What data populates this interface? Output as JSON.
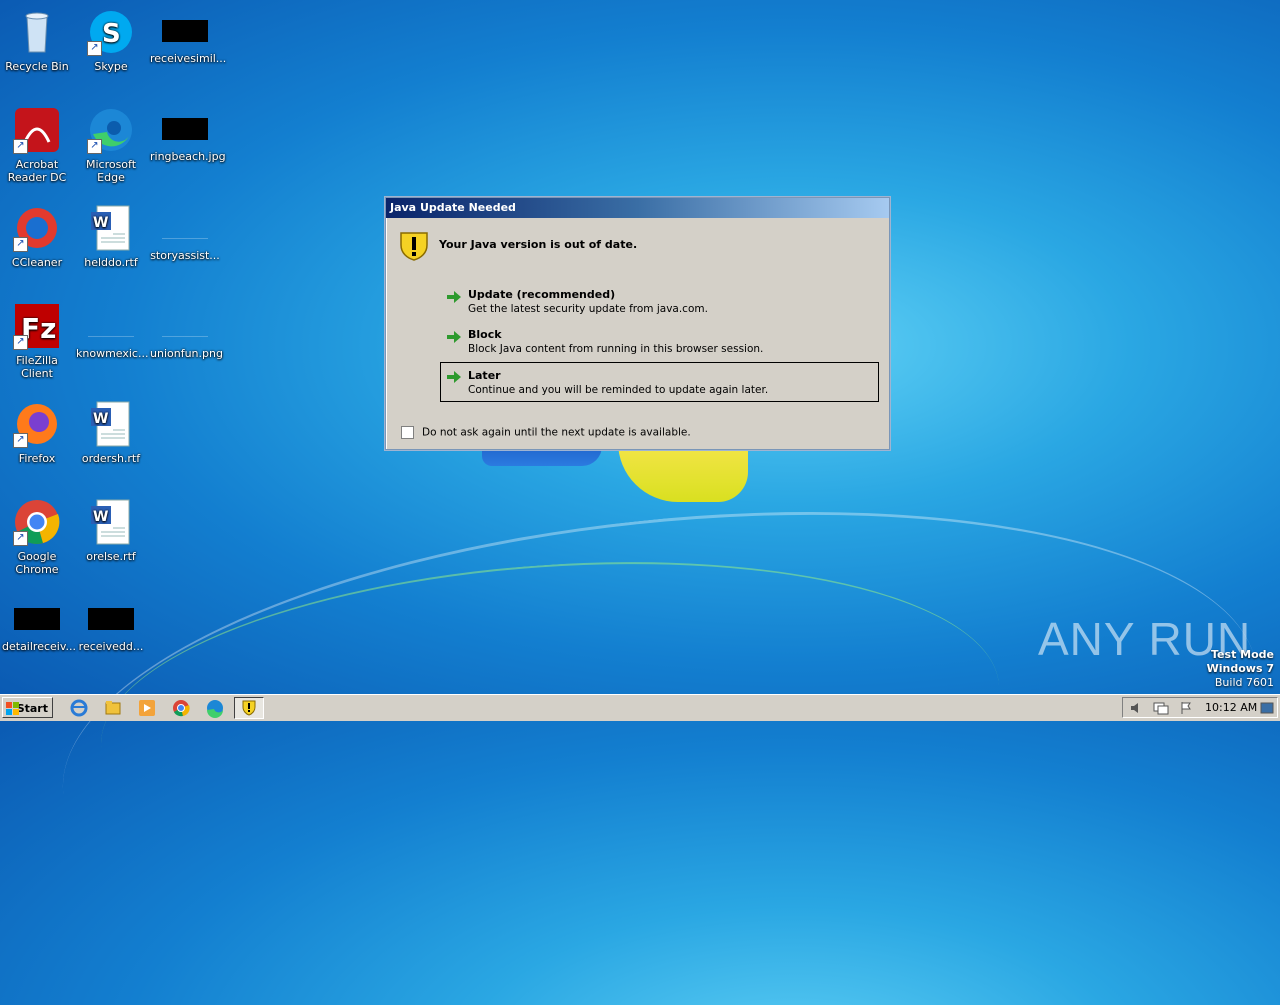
{
  "desktop": {
    "icons": [
      {
        "label": "Recycle Bin",
        "icon": "recycle-bin-icon"
      },
      {
        "label": "Skype",
        "icon": "skype-icon"
      },
      {
        "label": "receivesimil...",
        "icon": "image-thumbnail-icon"
      },
      {
        "label": "Acrobat Reader DC",
        "icon": "acrobat-icon"
      },
      {
        "label": "Microsoft Edge",
        "icon": "edge-icon"
      },
      {
        "label": "ringbeach.jpg",
        "icon": "image-thumbnail-icon"
      },
      {
        "label": "CCleaner",
        "icon": "ccleaner-icon"
      },
      {
        "label": "helddo.rtf",
        "icon": "word-document-icon"
      },
      {
        "label": "storyassist...",
        "icon": "file-icon"
      },
      {
        "label": "FileZilla Client",
        "icon": "filezilla-icon"
      },
      {
        "label": "knowmexic...",
        "icon": "file-icon"
      },
      {
        "label": "unionfun.png",
        "icon": "file-icon"
      },
      {
        "label": "Firefox",
        "icon": "firefox-icon"
      },
      {
        "label": "ordersh.rtf",
        "icon": "word-document-icon"
      },
      {
        "label": "Google Chrome",
        "icon": "chrome-icon"
      },
      {
        "label": "orelse.rtf",
        "icon": "word-document-icon"
      },
      {
        "label": "detailreceiv...",
        "icon": "image-thumbnail-icon"
      },
      {
        "label": "receivedd...",
        "icon": "image-thumbnail-icon"
      }
    ]
  },
  "dialog": {
    "title": "Java Update Needed",
    "heading": "Your Java version is out of date.",
    "options": [
      {
        "title": "Update (recommended)",
        "desc": "Get the latest security update from java.com."
      },
      {
        "title": "Block",
        "desc": "Block Java content from running in this browser session."
      },
      {
        "title": "Later",
        "desc": "Continue and you will be reminded to update again later."
      }
    ],
    "checkbox_label": "Do not ask again until the next update is available.",
    "checkbox_checked": false
  },
  "watermark": {
    "text": "ANY RUN"
  },
  "system_info": {
    "line1": "Test Mode",
    "line2": "Windows 7",
    "line3": "Build 7601"
  },
  "taskbar": {
    "start_label": "Start",
    "clock": "10:12 AM",
    "pinned": [
      "ie-icon",
      "explorer-icon",
      "media-player-icon",
      "chrome-icon",
      "edge-icon",
      "java-warning-icon"
    ]
  },
  "colors": {
    "accent": "#0a246a",
    "dialog_bg": "#d4d0c8",
    "arrow_green": "#2e9a2e"
  }
}
